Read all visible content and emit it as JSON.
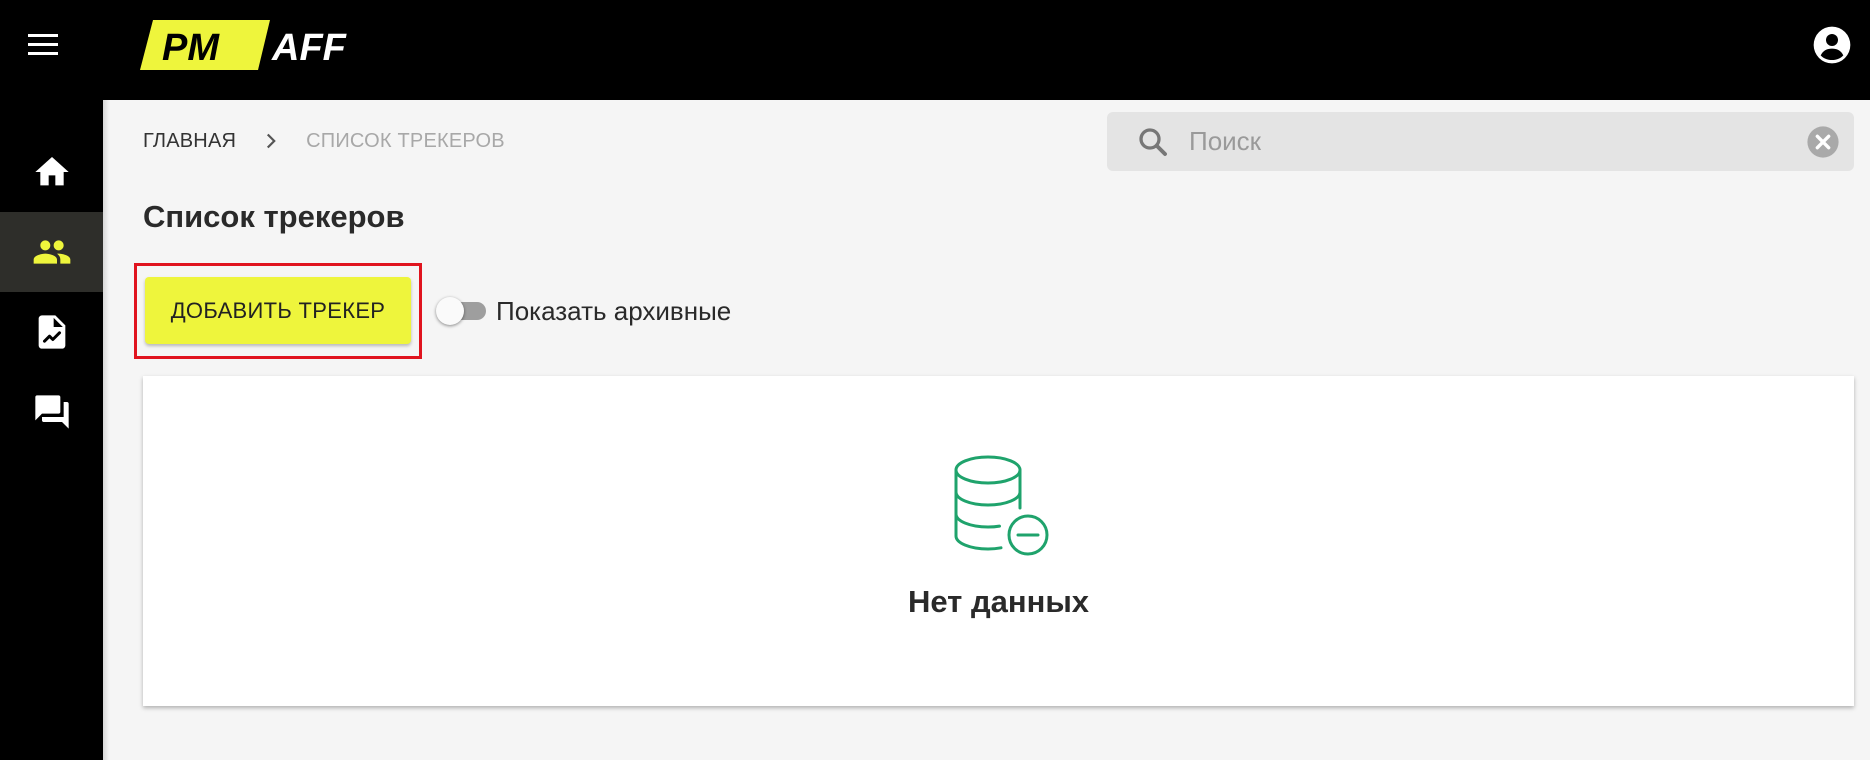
{
  "header": {
    "logo_text_1": "PM",
    "logo_text_2": "AFF",
    "menu_icon": "hamburger-menu-icon",
    "account_icon": "account-circle-icon"
  },
  "sidebar": {
    "items": [
      {
        "icon": "home-icon",
        "active": false
      },
      {
        "icon": "people-icon",
        "active": true
      },
      {
        "icon": "report-file-icon",
        "active": false
      },
      {
        "icon": "forum-icon",
        "active": false
      }
    ]
  },
  "breadcrumb": {
    "home": "ГЛАВНАЯ",
    "current": "СПИСОК ТРЕКЕРОВ"
  },
  "search": {
    "placeholder": "Поиск",
    "value": ""
  },
  "page": {
    "title": "Список трекеров",
    "add_button_label": "ДОБАВИТЬ ТРЕКЕР",
    "show_archived_label": "Показать архивные",
    "show_archived_checked": false
  },
  "empty_state": {
    "text": "Нет данных",
    "icon": "database-remove-icon"
  },
  "colors": {
    "accent_yellow": "#eef53c",
    "highlight_red": "#e0141e",
    "empty_icon_green": "#1fa36c",
    "active_sidebar_icon": "#eef53c"
  }
}
